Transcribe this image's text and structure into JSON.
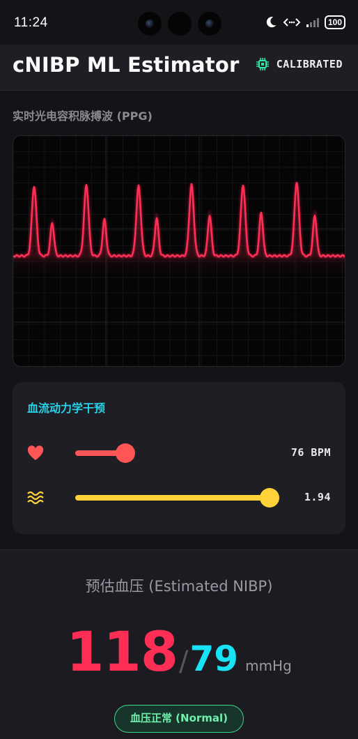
{
  "status_bar": {
    "time": "11:24",
    "battery": "100"
  },
  "header": {
    "title": "cNIBP ML Estimator",
    "calibration_status": "CALIBRATED",
    "accent_color": "#2ee6a6"
  },
  "ppg": {
    "label": "实时光电容积脉搏波 (PPG)",
    "waveform_color": "#ff2e55"
  },
  "hemodynamics": {
    "title": "血流动力学干预",
    "sliders": [
      {
        "icon": "heart-icon",
        "value_label": "76 BPM",
        "level": 0.2,
        "color": "#ff5555"
      },
      {
        "icon": "waves-icon",
        "value_label": "1.94",
        "level": 0.95,
        "color": "#ffd23a"
      }
    ]
  },
  "estimate": {
    "title": "预估血压 (Estimated NIBP)",
    "systolic": "118",
    "separator": "/",
    "diastolic": "79",
    "unit": "mmHg",
    "status": "血压正常 (Normal)",
    "systolic_color": "#ff2e55",
    "diastolic_color": "#18e2f4",
    "status_color": "#3ad88a"
  }
}
